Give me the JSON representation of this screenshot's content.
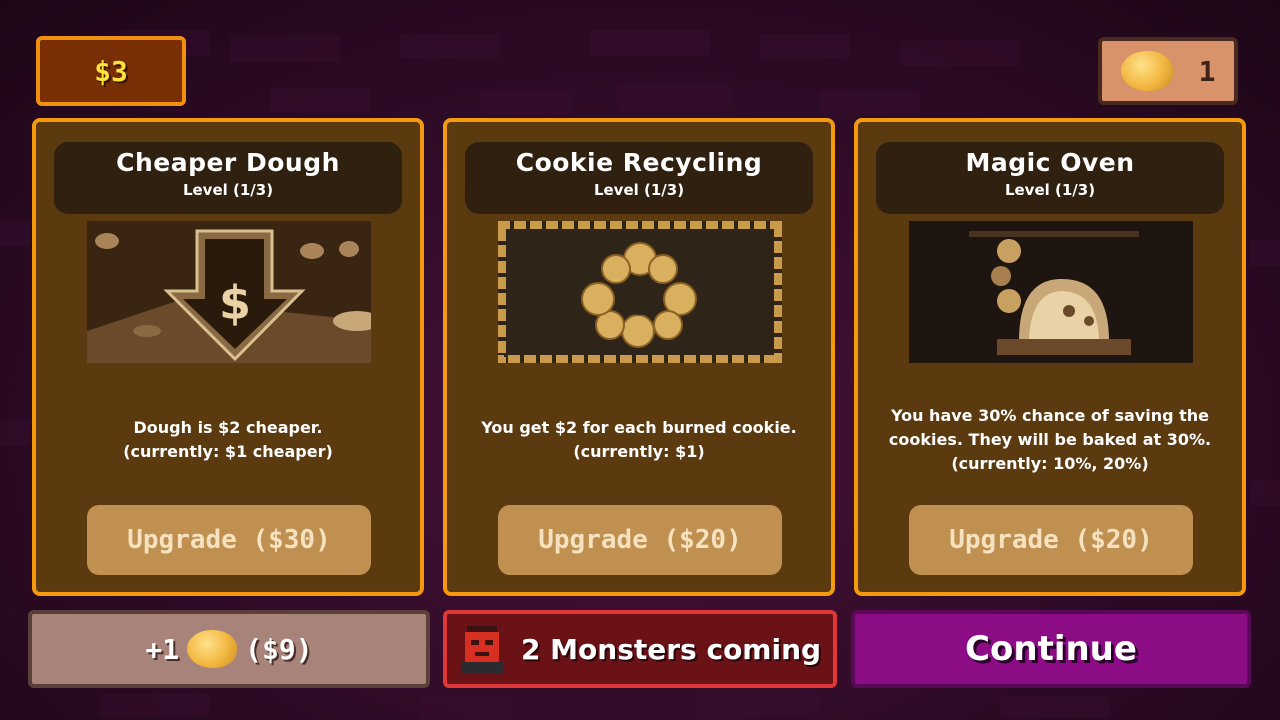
{
  "hud": {
    "money": "$3",
    "dough_count": "1",
    "dough_icon": "dough-icon"
  },
  "cards": [
    {
      "title": "Cheaper Dough",
      "level": "Level (1/3)",
      "desc_line1": "Dough is $2 cheaper.",
      "desc_line2": "(currently: $1 cheaper)",
      "desc_line3": "",
      "upgrade_label": "Upgrade ($30)",
      "art_icon": "dollar-down-arrow-icon"
    },
    {
      "title": "Cookie Recycling",
      "level": "Level (1/3)",
      "desc_line1": "You get $2 for each burned cookie.",
      "desc_line2": "(currently: $1)",
      "desc_line3": "",
      "upgrade_label": "Upgrade ($20)",
      "art_icon": "recycle-cookie-icon"
    },
    {
      "title": "Magic Oven",
      "level": "Level (1/3)",
      "desc_line1": "You have 30% chance of saving the",
      "desc_line2": "cookies. They will be baked at 30%.",
      "desc_line3": "(currently: 10%, 20%)",
      "upgrade_label": "Upgrade ($20)",
      "art_icon": "magic-oven-icon"
    }
  ],
  "footer": {
    "buy_dough_prefix": "+1",
    "buy_dough_price": "($9)",
    "monsters_label": "2 Monsters coming",
    "monster_icon": "monster-face-icon",
    "continue_label": "Continue"
  },
  "colors": {
    "card_border": "#f59a0e",
    "card_bg": "#5b3a10",
    "money_text": "#ffe23a",
    "continue_bg": "#8c0c86",
    "monsters_border": "#e03838"
  }
}
